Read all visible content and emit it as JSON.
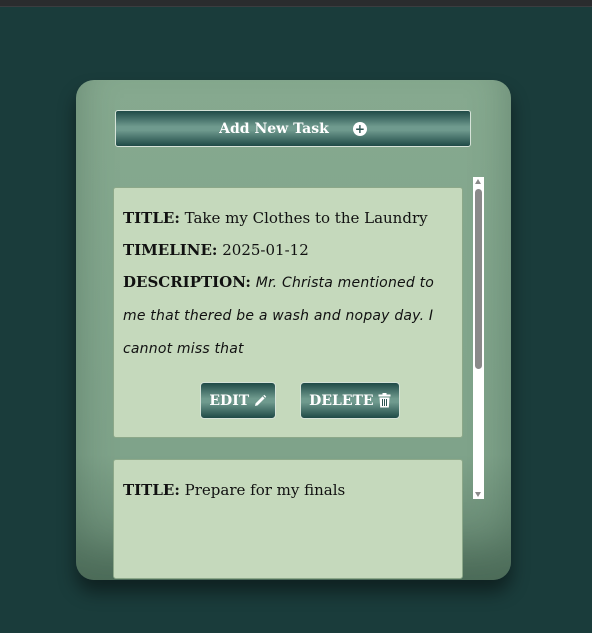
{
  "add_button": {
    "label": "Add New Task",
    "icon": "plus-circle-icon"
  },
  "tasks": [
    {
      "title_label": "TITLE:",
      "title": "Take my Clothes to the Laundry",
      "timeline_label": "TIMELINE:",
      "timeline": "2025-01-12",
      "description_label": "DESCRIPTION:",
      "description": "Mr. Christa mentioned to me that thered be a wash and nopay day. I cannot miss that",
      "edit_label": "EDIT",
      "delete_label": "DELETE"
    },
    {
      "title_label": "TITLE:",
      "title": "Prepare for my finals"
    }
  ],
  "colors": {
    "background": "#1a3c3b",
    "card": "#86a98f",
    "task_card": "#c5d9bc",
    "button_dark": "#1f4a47"
  }
}
